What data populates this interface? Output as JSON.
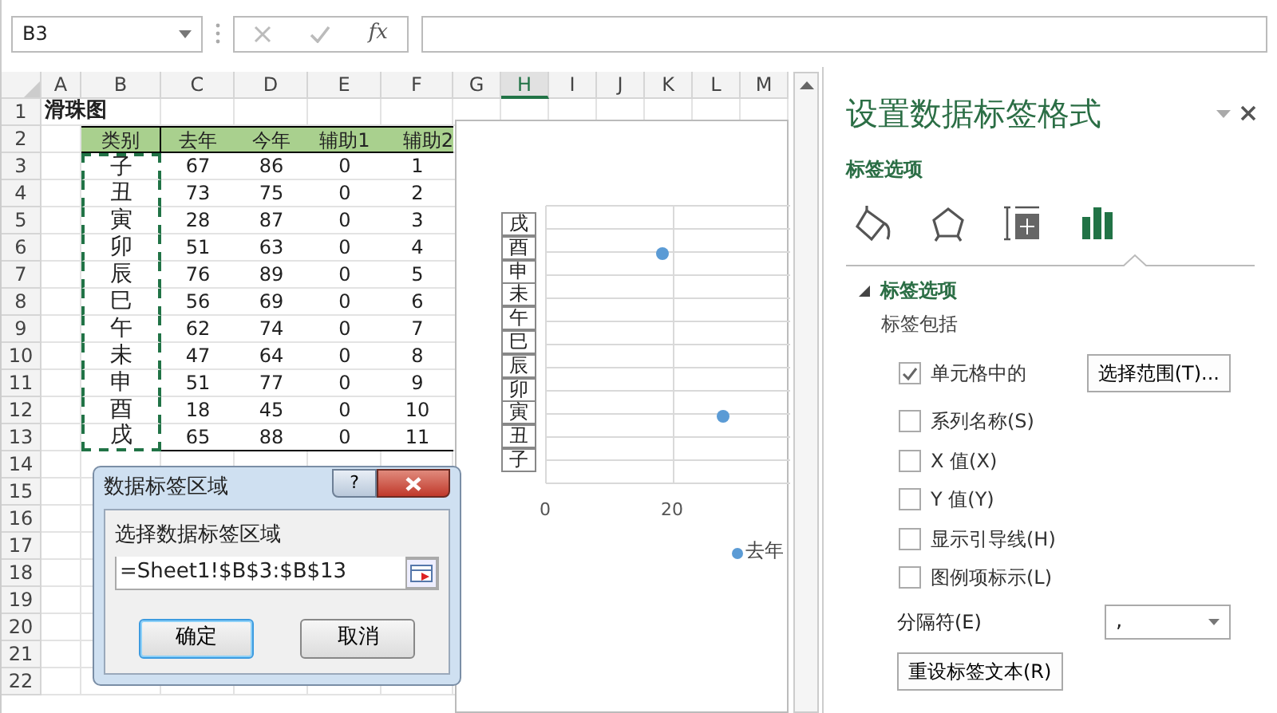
{
  "name_box": "B3",
  "formula_bar": {
    "fx": "fx"
  },
  "columns": [
    {
      "label": "A",
      "selected": false
    },
    {
      "label": "B",
      "selected": false
    },
    {
      "label": "C",
      "selected": false
    },
    {
      "label": "D",
      "selected": false
    },
    {
      "label": "E",
      "selected": false
    },
    {
      "label": "F",
      "selected": false
    },
    {
      "label": "G",
      "selected": false
    },
    {
      "label": "H",
      "selected": true
    },
    {
      "label": "I",
      "selected": false
    },
    {
      "label": "J",
      "selected": false
    },
    {
      "label": "K",
      "selected": false
    },
    {
      "label": "L",
      "selected": false
    },
    {
      "label": "M",
      "selected": false
    }
  ],
  "row_numbers": [
    "1",
    "2",
    "3",
    "4",
    "5",
    "6",
    "7",
    "8",
    "9",
    "10",
    "11",
    "12",
    "13",
    "14",
    "15",
    "16",
    "17",
    "18",
    "19",
    "20",
    "21",
    "22"
  ],
  "sheet": {
    "title": "滑珠图",
    "header": [
      "类别",
      "去年",
      "今年",
      "辅助1",
      "辅助2"
    ],
    "rows": [
      [
        "子",
        "67",
        "86",
        "0",
        "1"
      ],
      [
        "丑",
        "73",
        "75",
        "0",
        "2"
      ],
      [
        "寅",
        "28",
        "87",
        "0",
        "3"
      ],
      [
        "卯",
        "51",
        "63",
        "0",
        "4"
      ],
      [
        "辰",
        "76",
        "89",
        "0",
        "5"
      ],
      [
        "巳",
        "56",
        "69",
        "0",
        "6"
      ],
      [
        "午",
        "62",
        "74",
        "0",
        "7"
      ],
      [
        "未",
        "47",
        "64",
        "0",
        "8"
      ],
      [
        "申",
        "51",
        "77",
        "0",
        "9"
      ],
      [
        "酉",
        "18",
        "45",
        "0",
        "10"
      ],
      [
        "戌",
        "65",
        "88",
        "0",
        "11"
      ]
    ]
  },
  "chart": {
    "data_labels": [
      "戌",
      "酉",
      "申",
      "未",
      "午",
      "巳",
      "辰",
      "卯",
      "寅",
      "丑",
      "子"
    ],
    "x_tick_labels": [
      "0",
      "20"
    ],
    "legend": "去年"
  },
  "dialog": {
    "title": "数据标签区域",
    "help": "?",
    "prompt": "选择数据标签区域",
    "value": "=Sheet1!$B$3:$B$13",
    "buttons": [
      {
        "label": "确定",
        "focused": true
      },
      {
        "label": "取消",
        "focused": false
      }
    ]
  },
  "panel": {
    "title": "设置数据标签格式",
    "subtitle": "标签选项",
    "tabs": [
      {
        "kind": "fill",
        "selected": false
      },
      {
        "kind": "effects",
        "selected": false
      },
      {
        "kind": "size",
        "selected": false
      },
      {
        "kind": "options",
        "selected": true
      }
    ],
    "section": {
      "title": "标签选项",
      "expanded": true
    },
    "group_label": "标签包括",
    "options": [
      {
        "label": "单元格中的",
        "checked": true,
        "button": "选择范围(T)..."
      },
      {
        "label": "系列名称(S)",
        "checked": false
      },
      {
        "label": "X 值(X)",
        "checked": false
      },
      {
        "label": "Y 值(Y)",
        "checked": false
      },
      {
        "label": "显示引导线(H)",
        "checked": false
      },
      {
        "label": "图例项标示(L)",
        "checked": false
      }
    ],
    "separator": {
      "label": "分隔符(E)",
      "value": ","
    },
    "reset_button": "重设标签文本(R)"
  }
}
